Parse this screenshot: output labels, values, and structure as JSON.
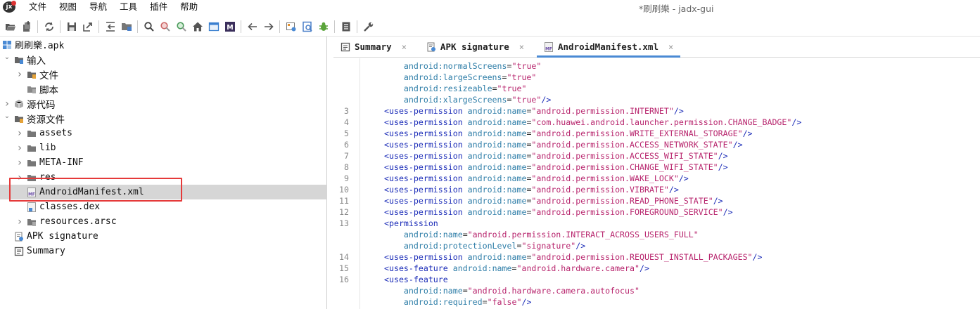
{
  "window": {
    "title": "*刷刷樂 - jadx-gui",
    "app_icon_text": "jx"
  },
  "menu": [
    "文件",
    "视图",
    "导航",
    "工具",
    "插件",
    "帮助"
  ],
  "toolbar": {
    "buttons": [
      "open-file",
      "add-files",
      "sync",
      "save-all",
      "export",
      "flatten",
      "packages",
      "search",
      "find-class",
      "find-usage",
      "home",
      "decompile-window",
      "smali",
      "back",
      "forward",
      "log-viewer",
      "quark",
      "debug",
      "show-log",
      "preferences"
    ]
  },
  "tree": {
    "items": [
      {
        "label": "刷刷樂.apk",
        "level": 0,
        "arrow": "",
        "icon": "apk-icon"
      },
      {
        "label": "输入",
        "level": 0,
        "arrow": "open",
        "icon": "input-folder-icon"
      },
      {
        "label": "文件",
        "level": 1,
        "arrow": "closed",
        "icon": "files-folder-icon"
      },
      {
        "label": "脚本",
        "level": 1,
        "arrow": "",
        "icon": "script-folder-icon"
      },
      {
        "label": "源代码",
        "level": 0,
        "arrow": "closed",
        "icon": "package-icon"
      },
      {
        "label": "资源文件",
        "level": 0,
        "arrow": "open",
        "icon": "resources-folder-icon"
      },
      {
        "label": "assets",
        "level": 1,
        "arrow": "closed",
        "icon": "folder-icon"
      },
      {
        "label": "lib",
        "level": 1,
        "arrow": "closed",
        "icon": "folder-icon"
      },
      {
        "label": "META-INF",
        "level": 1,
        "arrow": "closed",
        "icon": "folder-icon"
      },
      {
        "label": "res",
        "level": 1,
        "arrow": "closed",
        "icon": "folder-icon"
      },
      {
        "label": "AndroidManifest.xml",
        "level": 1,
        "arrow": "",
        "icon": "manifest-file-icon"
      },
      {
        "label": "classes.dex",
        "level": 1,
        "arrow": "",
        "icon": "dex-file-icon"
      },
      {
        "label": "resources.arsc",
        "level": 1,
        "arrow": "closed",
        "icon": "arsc-folder-icon"
      },
      {
        "label": "APK signature",
        "level": 0,
        "arrow": "",
        "icon": "signature-icon"
      },
      {
        "label": "Summary",
        "level": 0,
        "arrow": "",
        "icon": "summary-icon"
      }
    ]
  },
  "tabs": [
    {
      "label": "Summary",
      "close": "×",
      "icon": "summary-icon"
    },
    {
      "label": "APK signature",
      "close": "×",
      "icon": "signature-icon"
    },
    {
      "label": "AndroidManifest.xml",
      "close": "×",
      "icon": "manifest-file-icon"
    }
  ],
  "code": [
    {
      "ln": "",
      "indent": "    ",
      "parts": [
        [
          "attr",
          "android:normalScreens"
        ],
        [
          "plain",
          "="
        ],
        [
          "str",
          "\"true\""
        ]
      ]
    },
    {
      "ln": "",
      "indent": "    ",
      "parts": [
        [
          "attr",
          "android:largeScreens"
        ],
        [
          "plain",
          "="
        ],
        [
          "str",
          "\"true\""
        ]
      ]
    },
    {
      "ln": "",
      "indent": "    ",
      "parts": [
        [
          "attr",
          "android:resizeable"
        ],
        [
          "plain",
          "="
        ],
        [
          "str",
          "\"true\""
        ]
      ]
    },
    {
      "ln": "",
      "indent": "    ",
      "parts": [
        [
          "attr",
          "android:xlargeScreens"
        ],
        [
          "plain",
          "="
        ],
        [
          "str",
          "\"true\""
        ],
        [
          "tag",
          "/>"
        ]
      ]
    },
    {
      "ln": "3",
      "indent": "",
      "parts": [
        [
          "tag",
          "<uses-permission "
        ],
        [
          "attr",
          "android:name"
        ],
        [
          "plain",
          "="
        ],
        [
          "str",
          "\"android.permission.INTERNET\""
        ],
        [
          "tag",
          "/>"
        ]
      ]
    },
    {
      "ln": "4",
      "indent": "",
      "parts": [
        [
          "tag",
          "<uses-permission "
        ],
        [
          "attr",
          "android:name"
        ],
        [
          "plain",
          "="
        ],
        [
          "str",
          "\"com.huawei.android.launcher.permission.CHANGE_BADGE\""
        ],
        [
          "tag",
          "/>"
        ]
      ]
    },
    {
      "ln": "5",
      "indent": "",
      "parts": [
        [
          "tag",
          "<uses-permission "
        ],
        [
          "attr",
          "android:name"
        ],
        [
          "plain",
          "="
        ],
        [
          "str",
          "\"android.permission.WRITE_EXTERNAL_STORAGE\""
        ],
        [
          "tag",
          "/>"
        ]
      ]
    },
    {
      "ln": "6",
      "indent": "",
      "parts": [
        [
          "tag",
          "<uses-permission "
        ],
        [
          "attr",
          "android:name"
        ],
        [
          "plain",
          "="
        ],
        [
          "str",
          "\"android.permission.ACCESS_NETWORK_STATE\""
        ],
        [
          "tag",
          "/>"
        ]
      ]
    },
    {
      "ln": "7",
      "indent": "",
      "parts": [
        [
          "tag",
          "<uses-permission "
        ],
        [
          "attr",
          "android:name"
        ],
        [
          "plain",
          "="
        ],
        [
          "str",
          "\"android.permission.ACCESS_WIFI_STATE\""
        ],
        [
          "tag",
          "/>"
        ]
      ]
    },
    {
      "ln": "8",
      "indent": "",
      "parts": [
        [
          "tag",
          "<uses-permission "
        ],
        [
          "attr",
          "android:name"
        ],
        [
          "plain",
          "="
        ],
        [
          "str",
          "\"android.permission.CHANGE_WIFI_STATE\""
        ],
        [
          "tag",
          "/>"
        ]
      ]
    },
    {
      "ln": "9",
      "indent": "",
      "parts": [
        [
          "tag",
          "<uses-permission "
        ],
        [
          "attr",
          "android:name"
        ],
        [
          "plain",
          "="
        ],
        [
          "str",
          "\"android.permission.WAKE_LOCK\""
        ],
        [
          "tag",
          "/>"
        ]
      ]
    },
    {
      "ln": "10",
      "indent": "",
      "parts": [
        [
          "tag",
          "<uses-permission "
        ],
        [
          "attr",
          "android:name"
        ],
        [
          "plain",
          "="
        ],
        [
          "str",
          "\"android.permission.VIBRATE\""
        ],
        [
          "tag",
          "/>"
        ]
      ]
    },
    {
      "ln": "11",
      "indent": "",
      "parts": [
        [
          "tag",
          "<uses-permission "
        ],
        [
          "attr",
          "android:name"
        ],
        [
          "plain",
          "="
        ],
        [
          "str",
          "\"android.permission.READ_PHONE_STATE\""
        ],
        [
          "tag",
          "/>"
        ]
      ]
    },
    {
      "ln": "12",
      "indent": "",
      "parts": [
        [
          "tag",
          "<uses-permission "
        ],
        [
          "attr",
          "android:name"
        ],
        [
          "plain",
          "="
        ],
        [
          "str",
          "\"android.permission.FOREGROUND_SERVICE\""
        ],
        [
          "tag",
          "/>"
        ]
      ]
    },
    {
      "ln": "13",
      "indent": "",
      "parts": [
        [
          "tag",
          "<permission"
        ]
      ]
    },
    {
      "ln": "",
      "indent": "    ",
      "parts": [
        [
          "attr",
          "android:name"
        ],
        [
          "plain",
          "="
        ],
        [
          "str",
          "\"android.permission.INTERACT_ACROSS_USERS_FULL\""
        ]
      ]
    },
    {
      "ln": "",
      "indent": "    ",
      "parts": [
        [
          "attr",
          "android:protectionLevel"
        ],
        [
          "plain",
          "="
        ],
        [
          "str",
          "\"signature\""
        ],
        [
          "tag",
          "/>"
        ]
      ]
    },
    {
      "ln": "14",
      "indent": "",
      "parts": [
        [
          "tag",
          "<uses-permission "
        ],
        [
          "attr",
          "android:name"
        ],
        [
          "plain",
          "="
        ],
        [
          "str",
          "\"android.permission.REQUEST_INSTALL_PACKAGES\""
        ],
        [
          "tag",
          "/>"
        ]
      ]
    },
    {
      "ln": "15",
      "indent": "",
      "parts": [
        [
          "tag",
          "<uses-feature "
        ],
        [
          "attr",
          "android:name"
        ],
        [
          "plain",
          "="
        ],
        [
          "str",
          "\"android.hardware.camera\""
        ],
        [
          "tag",
          "/>"
        ]
      ]
    },
    {
      "ln": "16",
      "indent": "",
      "parts": [
        [
          "tag",
          "<uses-feature"
        ]
      ]
    },
    {
      "ln": "",
      "indent": "    ",
      "parts": [
        [
          "attr",
          "android:name"
        ],
        [
          "plain",
          "="
        ],
        [
          "str",
          "\"android.hardware.camera.autofocus\""
        ]
      ]
    },
    {
      "ln": "",
      "indent": "    ",
      "parts": [
        [
          "attr",
          "android:required"
        ],
        [
          "plain",
          "="
        ],
        [
          "str",
          "\"false\""
        ],
        [
          "tag",
          "/>"
        ]
      ]
    }
  ]
}
